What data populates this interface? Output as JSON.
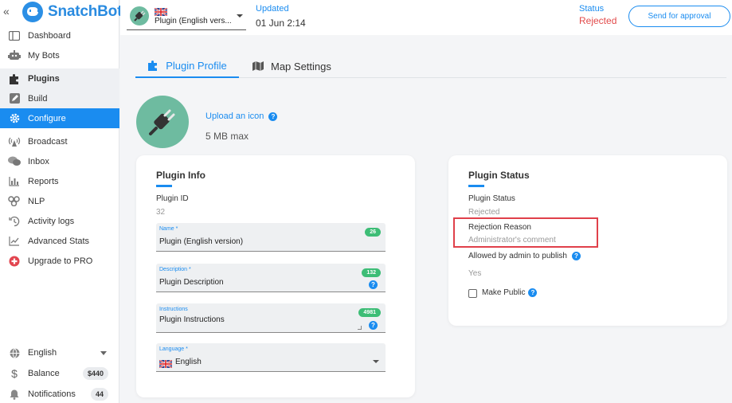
{
  "brand": {
    "collapse_glyph": "«",
    "name": "SnatchBot",
    "logo_icon": "robot-logo-icon"
  },
  "sidebar": {
    "items": [
      {
        "label": "Dashboard",
        "icon": "dashboard-icon"
      },
      {
        "label": "My Bots",
        "icon": "bot-icon"
      },
      {
        "label": "Plugins",
        "icon": "puzzle-icon"
      },
      {
        "label": "Build",
        "icon": "pencil-icon"
      },
      {
        "label": "Configure",
        "icon": "gear-icon"
      },
      {
        "label": "Broadcast",
        "icon": "broadcast-icon"
      },
      {
        "label": "Inbox",
        "icon": "chat-icon"
      },
      {
        "label": "Reports",
        "icon": "bar-chart-icon"
      },
      {
        "label": "NLP",
        "icon": "nlp-icon"
      },
      {
        "label": "Activity logs",
        "icon": "history-icon"
      },
      {
        "label": "Advanced Stats",
        "icon": "line-chart-icon"
      },
      {
        "label": "Upgrade to PRO",
        "icon": "upgrade-icon"
      }
    ],
    "bottom": {
      "language": "English",
      "balance_label": "Balance",
      "balance_value": "$440",
      "notifications_label": "Notifications",
      "notifications_count": "44"
    }
  },
  "topbar": {
    "plugin_name": "Plugin (English vers...",
    "updated_label": "Updated",
    "updated_value": "01 Jun 2:14",
    "status_label": "Status",
    "status_value": "Rejected",
    "approval_button": "Send for approval"
  },
  "tabs": [
    {
      "label": "Plugin Profile",
      "icon": "puzzle-icon",
      "active": true
    },
    {
      "label": "Map Settings",
      "icon": "map-icon",
      "active": false
    }
  ],
  "icon_upload": {
    "link": "Upload an icon",
    "max": "5 MB max"
  },
  "plugin_info": {
    "title": "Plugin Info",
    "id_label": "Plugin ID",
    "id_value": "32",
    "name_label": "Name *",
    "name_value": "Plugin (English version)",
    "name_count": "26",
    "desc_label": "Description *",
    "desc_value": "Plugin Description",
    "desc_count": "132",
    "instr_label": "Instructions",
    "instr_value": "Plugin Instructions",
    "instr_count": "4981",
    "lang_label": "Language *",
    "lang_value": "English"
  },
  "plugin_status": {
    "title": "Plugin Status",
    "status_label": "Plugin Status",
    "status_value": "Rejected",
    "reason_label": "Rejection Reason",
    "reason_value": "Administrator's comment",
    "allowed_label": "Allowed by admin to publish",
    "allowed_value": "Yes",
    "public_label": "Make Public"
  },
  "colors": {
    "accent": "#1a8cf0",
    "rejected": "#e24a4a",
    "counter": "#3dbd76",
    "avatar": "#6ebba0",
    "highlight_box": "#e0404a"
  }
}
